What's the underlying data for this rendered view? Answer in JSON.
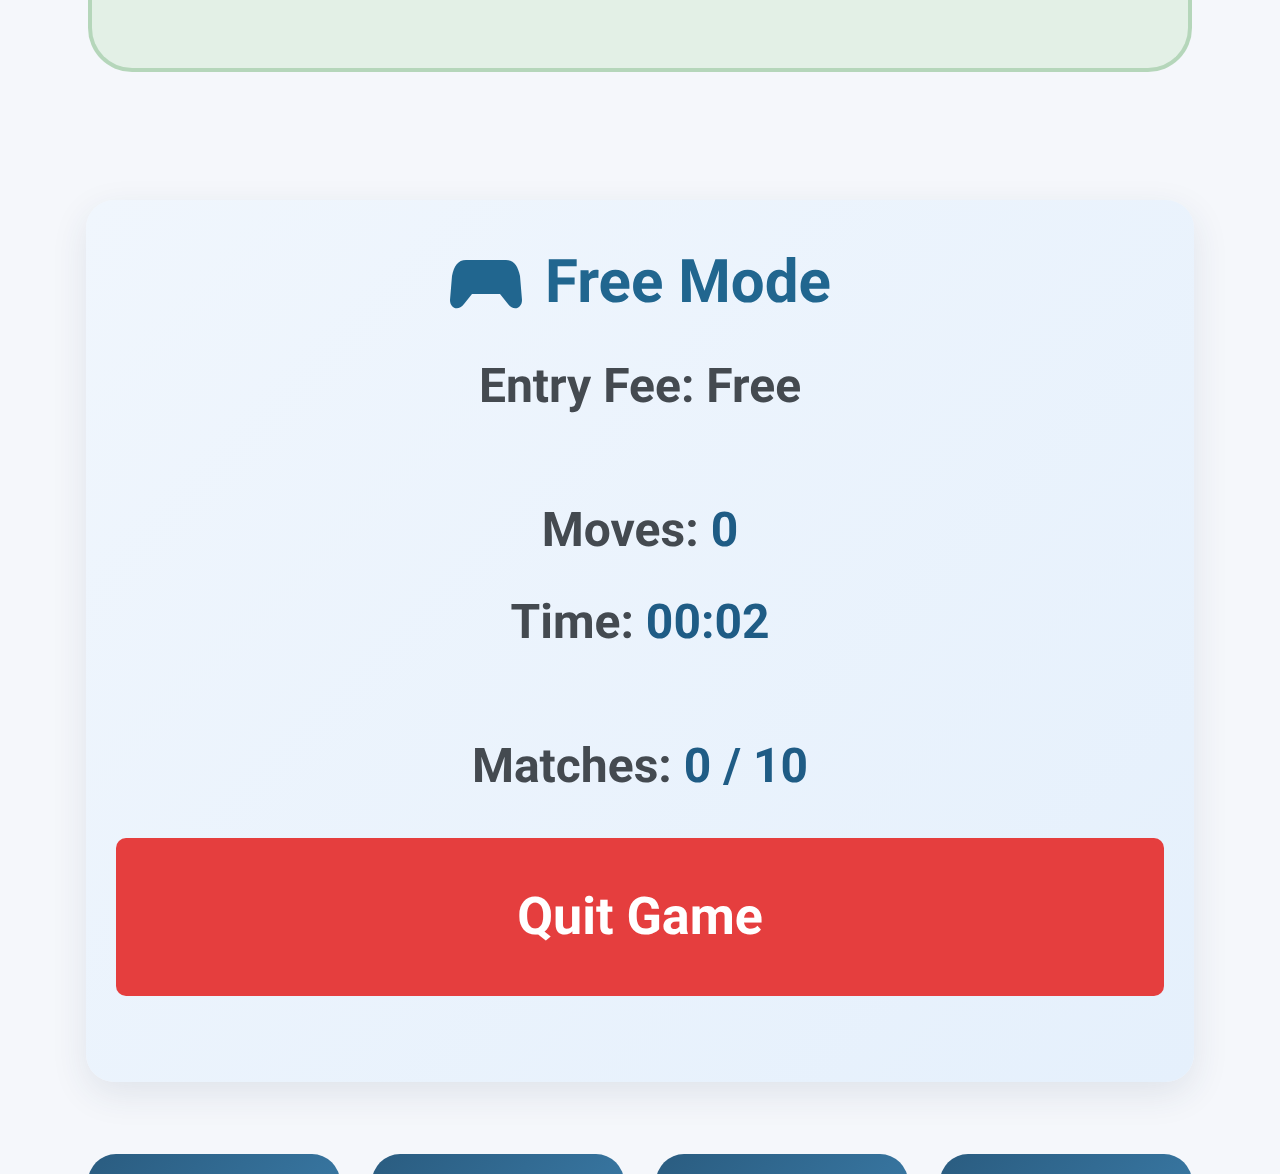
{
  "banner": {
    "kind": "success"
  },
  "game": {
    "title": "Free Mode",
    "entry_fee": {
      "label": "Entry Fee:",
      "value": "Free"
    },
    "stats": [
      {
        "label": "Moves:",
        "value": "0"
      },
      {
        "label": "Time:",
        "value": "00:02"
      },
      {
        "label": "Matches:",
        "value": "0 / 10"
      }
    ],
    "quit_button": "Quit Game"
  },
  "cards": [
    {
      "kind": "face-down"
    },
    {
      "kind": "face-down"
    },
    {
      "kind": "face-down"
    },
    {
      "kind": "face-down"
    }
  ]
}
